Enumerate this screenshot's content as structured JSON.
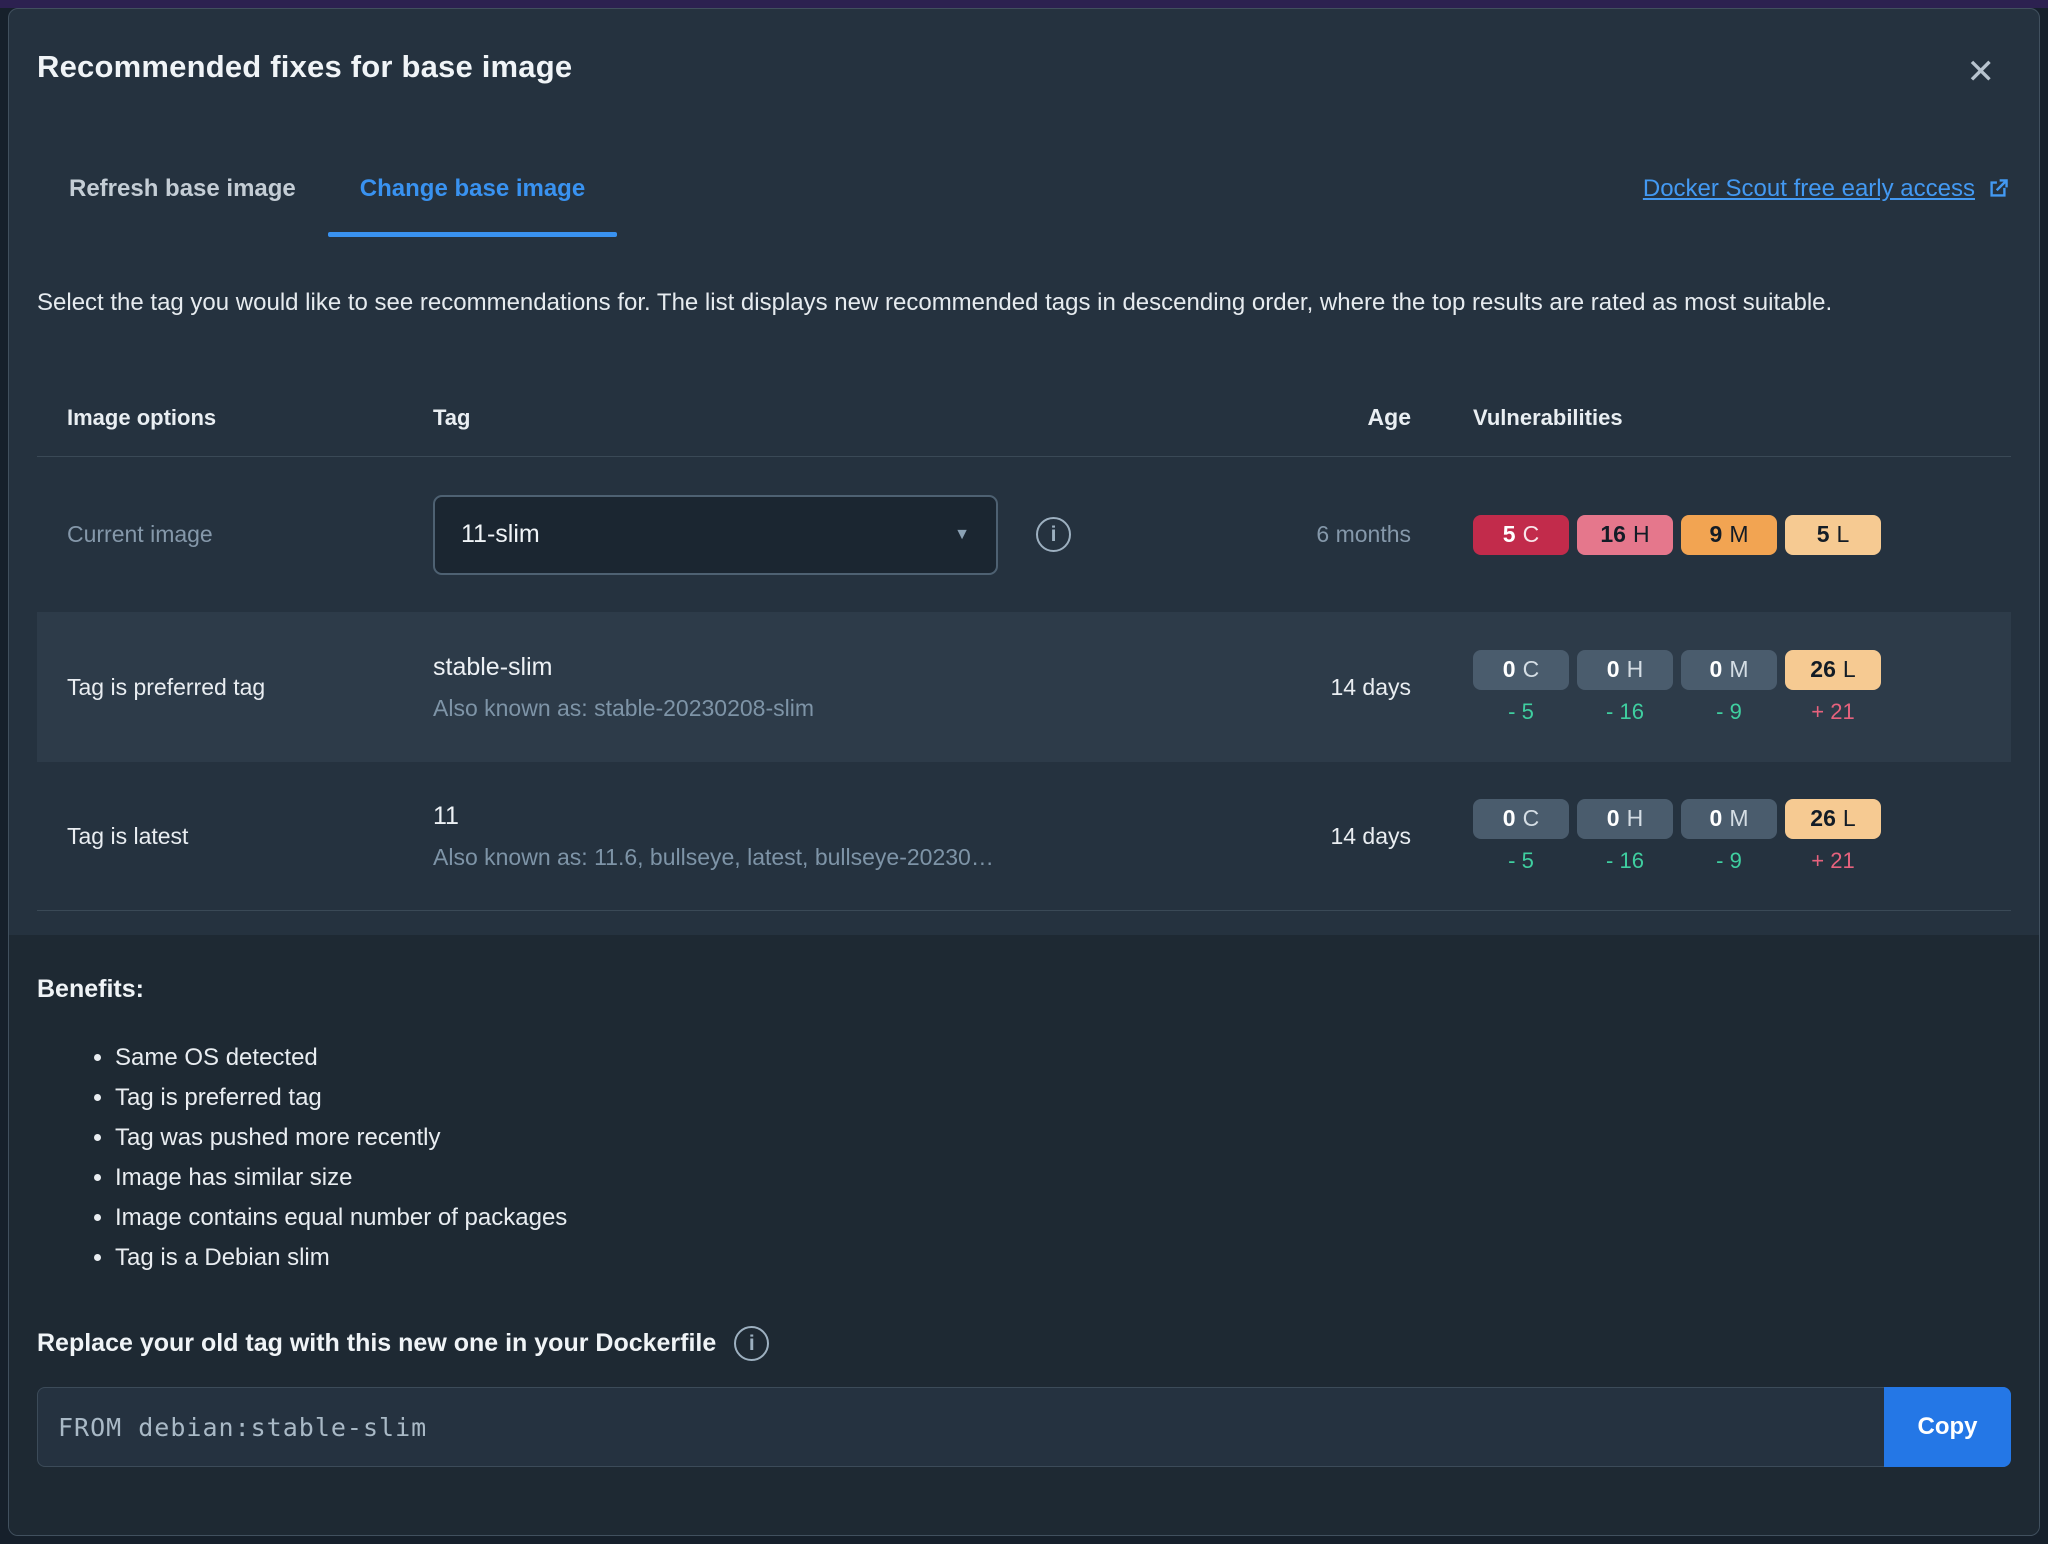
{
  "colors": {
    "accent_blue": "#3992f0",
    "link_blue": "#4399f2",
    "copy_button_blue": "#2477e6",
    "badge_critical": "#c22b4b",
    "badge_high": "#e5778c",
    "badge_medium": "#f2a452",
    "badge_low": "#f6ca92",
    "badge_neutral": "#4a5c6d",
    "delta_down_green": "#3fcfa0",
    "delta_up_pink": "#e7627d",
    "dialog_bg": "#25323f",
    "panel_bg": "#1e2933",
    "highlight_row_bg": "#2d3b49"
  },
  "icons": {
    "close": "✕",
    "caret": "▼",
    "info": "i"
  },
  "dialog": {
    "title": "Recommended fixes for base image"
  },
  "header": {
    "tabs": [
      {
        "label": "Refresh base image",
        "active": false
      },
      {
        "label": "Change base image",
        "active": true
      }
    ],
    "link_label": "Docker Scout free early access"
  },
  "description": "Select the tag you would like to see recommendations for. The list displays new recommended tags in descending order, where the top results are rated as most suitable.",
  "table": {
    "headers": {
      "image_options": "Image options",
      "tag": "Tag",
      "age": "Age",
      "vulnerabilities": "Vulnerabilities"
    },
    "rows": [
      {
        "option": "Current image",
        "selected_tag": "11-slim",
        "age": "6 months",
        "badges": [
          {
            "count": "5",
            "letter": "C"
          },
          {
            "count": "16",
            "letter": "H"
          },
          {
            "count": "9",
            "letter": "M"
          },
          {
            "count": "5",
            "letter": "L"
          }
        ]
      },
      {
        "option": "Tag is preferred tag",
        "tag": "stable-slim",
        "alias": "Also known as: stable-20230208-slim",
        "age": "14 days",
        "badges": [
          {
            "count": "0",
            "letter": "C",
            "delta": "- 5"
          },
          {
            "count": "0",
            "letter": "H",
            "delta": "- 16"
          },
          {
            "count": "0",
            "letter": "M",
            "delta": "- 9"
          },
          {
            "count": "26",
            "letter": "L",
            "delta": "+ 21"
          }
        ]
      },
      {
        "option": "Tag is latest",
        "tag": "11",
        "alias": "Also known as: 11.6, bullseye, latest, bullseye-20230…",
        "age": "14 days",
        "badges": [
          {
            "count": "0",
            "letter": "C",
            "delta": "- 5"
          },
          {
            "count": "0",
            "letter": "H",
            "delta": "- 16"
          },
          {
            "count": "0",
            "letter": "M",
            "delta": "- 9"
          },
          {
            "count": "26",
            "letter": "L",
            "delta": "+ 21"
          }
        ]
      }
    ]
  },
  "benefits": {
    "heading": "Benefits:",
    "items": [
      "Same OS detected",
      "Tag is preferred tag",
      "Tag was pushed more recently",
      "Image has similar size",
      "Image contains equal number of packages",
      "Tag is a Debian slim"
    ]
  },
  "dockerfile": {
    "heading": "Replace your old tag with this new one in your Dockerfile",
    "code": "FROM debian:stable-slim",
    "copy_label": "Copy"
  }
}
